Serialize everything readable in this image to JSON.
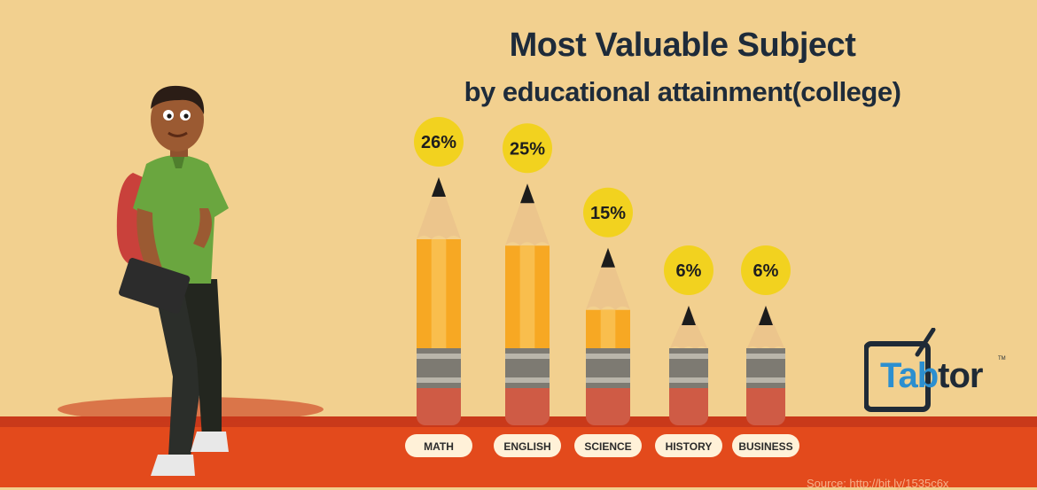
{
  "title": "Most Valuable Subject",
  "subtitle": "by educational attainment(college)",
  "source": "Source: http://bit.ly/1535c6x",
  "logo": {
    "brand_first": "Tab",
    "brand_rest": "tor",
    "tm": "TM"
  },
  "colors": {
    "background": "#f2d08f",
    "floor": "#e34a1c",
    "badge": "#f2d21f",
    "pencil_body": "#f7a823",
    "pencil_eraser": "#cf5b45",
    "pencil_band": "#7d7a72"
  },
  "icons": [
    "student-figure",
    "tablet-logo-icon"
  ],
  "chart_data": {
    "type": "bar",
    "title": "Most Valuable Subject",
    "subtitle": "by educational attainment(college)",
    "categories": [
      "MATH",
      "ENGLISH",
      "SCIENCE",
      "HISTORY",
      "BUSINESS"
    ],
    "values": [
      26,
      25,
      15,
      6,
      6
    ],
    "value_labels": [
      "26%",
      "25%",
      "15%",
      "6%",
      "6%"
    ],
    "unit": "%",
    "legend": "none",
    "grid": false
  }
}
